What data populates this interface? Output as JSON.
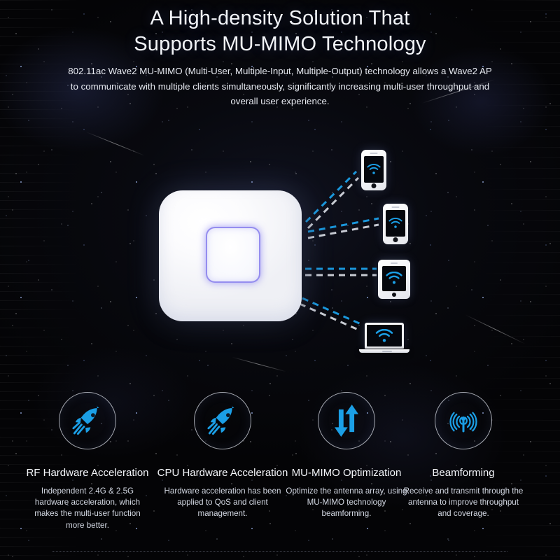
{
  "meta": {
    "accent_blue": "#1b9fe6",
    "led_purple": "#786aeb",
    "background": "#05050a",
    "text_color": "#f2f4f8"
  },
  "hero": {
    "title_line1": "A High-density Solution That",
    "title_line2": "Supports MU-MIMO Technology",
    "body": "802.11ac Wave2 MU-MIMO (Multi-User, Multiple-Input, Multiple-Output) technology allows a Wave2 AP to communicate with multiple clients simultaneously, significantly increasing multi-user throughput and overall user experience."
  },
  "diagram": {
    "access_point": {
      "name": "wireless-access-point",
      "led_label": "led-indicator"
    },
    "clients": [
      {
        "type": "smartphone",
        "icon": "wifi-icon"
      },
      {
        "type": "smartphone",
        "icon": "wifi-icon"
      },
      {
        "type": "tablet",
        "icon": "wifi-icon"
      },
      {
        "type": "laptop",
        "icon": "wifi-icon"
      }
    ],
    "links": [
      {
        "target": "smartphone-1",
        "style": "dashed-dual",
        "colors": [
          "#1b9fe6",
          "#e9edf4"
        ]
      },
      {
        "target": "smartphone-2",
        "style": "dashed-dual",
        "colors": [
          "#1b9fe6",
          "#e9edf4"
        ]
      },
      {
        "target": "tablet",
        "style": "dashed-dual",
        "colors": [
          "#1b9fe6",
          "#e9edf4"
        ]
      },
      {
        "target": "laptop",
        "style": "dashed-dual",
        "colors": [
          "#1b9fe6",
          "#e9edf4"
        ]
      }
    ]
  },
  "features": [
    {
      "icon": "rocket-icon",
      "title": "RF Hardware Acceleration",
      "desc": "Independent 2.4G & 2.5G hardware acceleration, which makes the multi-user function more better."
    },
    {
      "icon": "rocket-icon",
      "title": "CPU Hardware Acceleration",
      "desc": "Hardware acceleration has been applied to QoS and client management."
    },
    {
      "icon": "up-down-arrows-icon",
      "title": "MU-MIMO Optimization",
      "desc": "Optimize the antenna array, using MU-MIMO technology beamforming."
    },
    {
      "icon": "antenna-broadcast-icon",
      "title": "Beamforming",
      "desc": "Receive and transmit through the antenna to improve throughput and coverage."
    }
  ]
}
